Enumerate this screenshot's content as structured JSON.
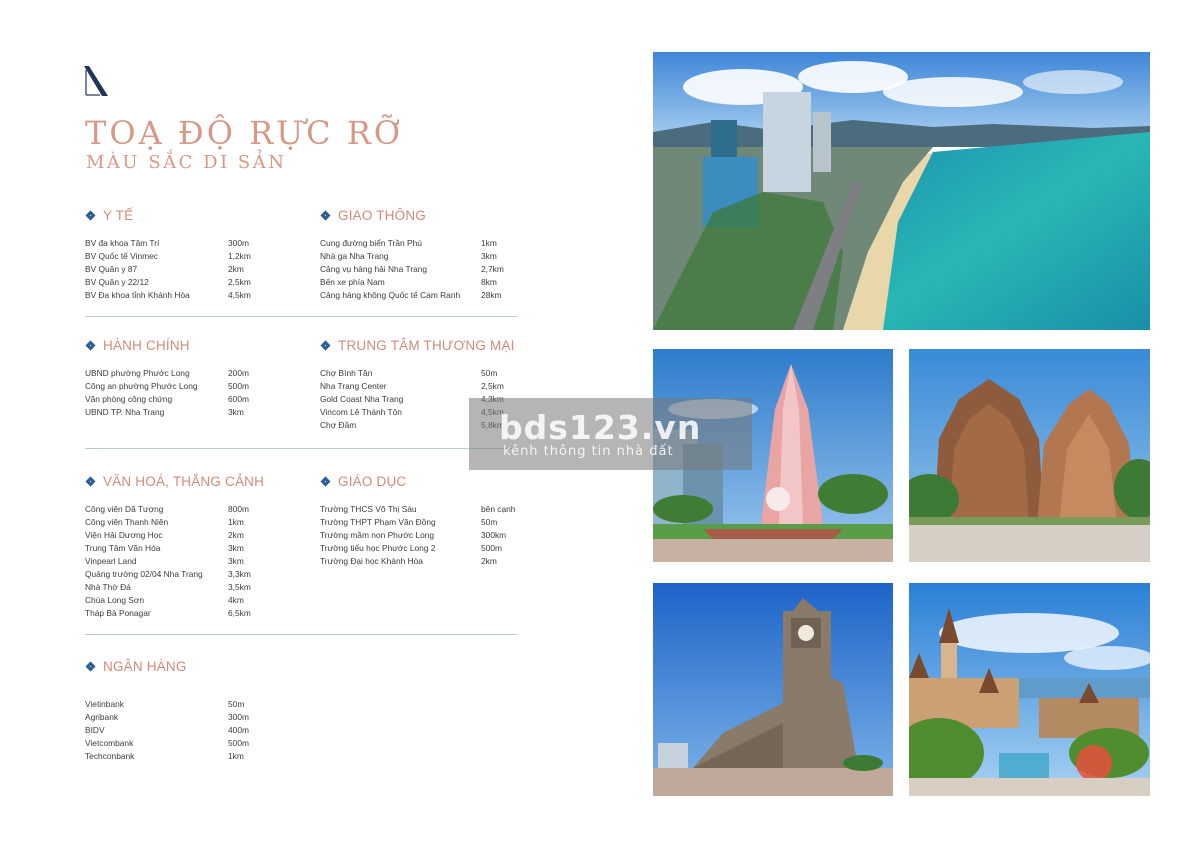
{
  "header": {
    "title": "TOẠ ĐỘ RỰC RỠ",
    "subtitle": "MÀU SẮC DI SẢN"
  },
  "sections": {
    "yte": {
      "title": "Y TẾ",
      "items": [
        {
          "name": "BV đa khoa Tâm Trí",
          "dist": "300m"
        },
        {
          "name": "BV Quốc tế Vinmec",
          "dist": "1,2km"
        },
        {
          "name": "BV Quân y 87",
          "dist": "2km"
        },
        {
          "name": "BV Quân y 22/12",
          "dist": "2,5km"
        },
        {
          "name": "BV Đa khoa tỉnh Khánh Hòa",
          "dist": "4,5km"
        }
      ]
    },
    "giaothong": {
      "title": "GIAO THÔNG",
      "items": [
        {
          "name": "Cung đường biển Trần Phú",
          "dist": "1km"
        },
        {
          "name": "Nhà ga Nha Trang",
          "dist": "3km"
        },
        {
          "name": "Cảng vụ hàng hải Nha Trang",
          "dist": "2,7km"
        },
        {
          "name": "Bến xe phía Nam",
          "dist": "8km"
        },
        {
          "name": "Cảng hàng không Quốc tế Cam Ranh",
          "dist": "28km"
        }
      ]
    },
    "hanhchinh": {
      "title": "HÀNH CHÍNH",
      "items": [
        {
          "name": "UBND phường Phước Long",
          "dist": "200m"
        },
        {
          "name": "Công an phường Phước Long",
          "dist": "500m"
        },
        {
          "name": "Văn phòng công chứng",
          "dist": "600m"
        },
        {
          "name": "UBND TP. Nha Trang",
          "dist": "3km"
        }
      ]
    },
    "thuongmai": {
      "title": "TRUNG TÂM THƯƠNG MẠI",
      "items": [
        {
          "name": "Chợ Bình Tân",
          "dist": "50m"
        },
        {
          "name": "Nha Trang Center",
          "dist": "2,5km"
        },
        {
          "name": "Gold Coast Nha Trang",
          "dist": "4,3km"
        },
        {
          "name": "Vincom Lê Thánh Tôn",
          "dist": "4,5km"
        },
        {
          "name": "Chợ Đầm",
          "dist": "5,8km"
        }
      ]
    },
    "vanhoa": {
      "title": "VĂN HOÁ, THẮNG CẢNH",
      "items": [
        {
          "name": "Công viên Dã Tượng",
          "dist": "800m"
        },
        {
          "name": "Công viên Thanh Niên",
          "dist": "1km"
        },
        {
          "name": "Viện Hải Dương Học",
          "dist": "2km"
        },
        {
          "name": "Trung Tâm Văn Hóa",
          "dist": "3km"
        },
        {
          "name": "Vinpearl Land",
          "dist": "3km"
        },
        {
          "name": "Quảng trường 02/04 Nha Trang",
          "dist": "3,3km"
        },
        {
          "name": "Nhà Thờ Đá",
          "dist": "3,5km"
        },
        {
          "name": "Chùa Long Sơn",
          "dist": "4km"
        },
        {
          "name": "Tháp Bà Ponagar",
          "dist": "6,5km"
        }
      ]
    },
    "giaoduc": {
      "title": "GIÁO DỤC",
      "items": [
        {
          "name": "Trường THCS Võ Thị Sáu",
          "dist": "bên cạnh"
        },
        {
          "name": "Trường THPT Phạm Văn Đồng",
          "dist": "50m"
        },
        {
          "name": "Trường mầm non Phước Long",
          "dist": "300km"
        },
        {
          "name": "Trường tiểu học Phước Long 2",
          "dist": "500m"
        },
        {
          "name": "Trường Đại học Khánh Hòa",
          "dist": "2km"
        }
      ]
    },
    "nganhang": {
      "title": "NGÂN HÀNG",
      "items": [
        {
          "name": "Vietinbank",
          "dist": "50m"
        },
        {
          "name": "Agribank",
          "dist": "300m"
        },
        {
          "name": "BIDV",
          "dist": "400m"
        },
        {
          "name": "Vietcombank",
          "dist": "500m"
        },
        {
          "name": "Techconbank",
          "dist": "1km"
        }
      ]
    }
  },
  "watermark": {
    "main": "bds123.vn",
    "sub": "kênh thông tin nhà đất"
  },
  "colors": {
    "accent": "#d79987",
    "diamond": "#2c5f93"
  }
}
